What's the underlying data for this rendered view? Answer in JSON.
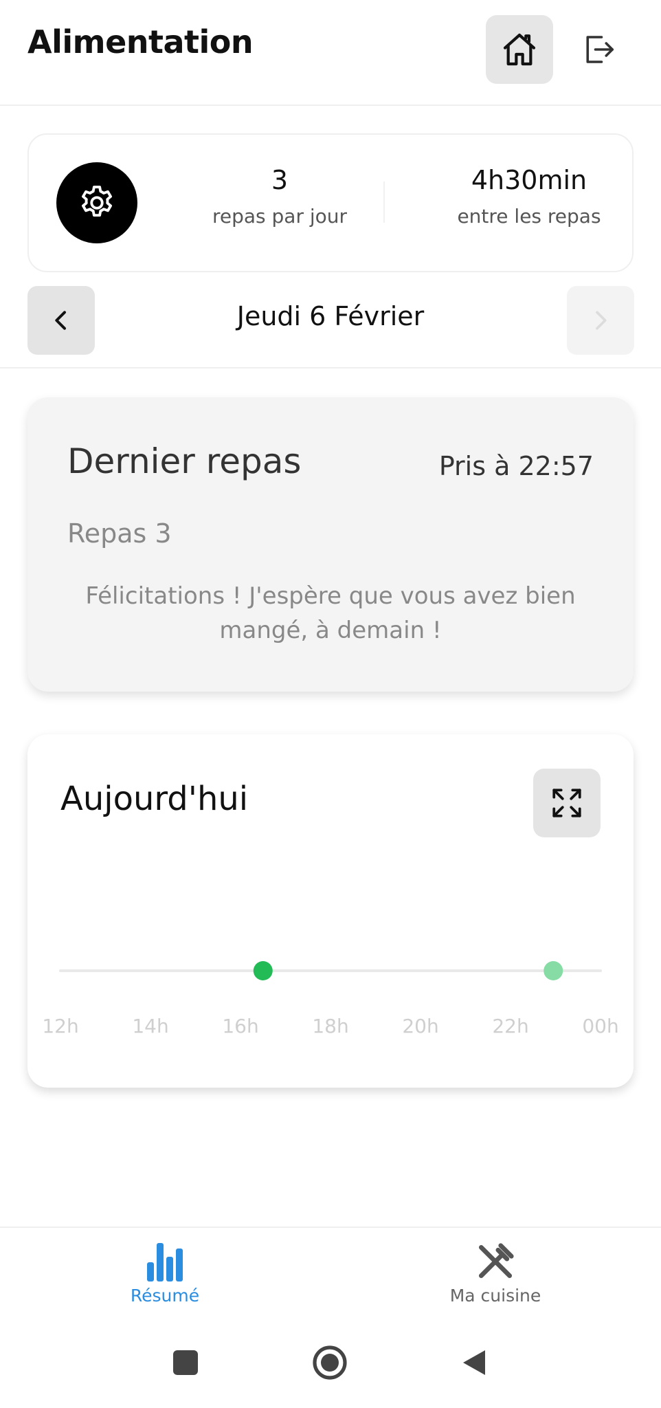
{
  "header": {
    "title": "Alimentation",
    "home_icon": "home-icon",
    "logout_icon": "logout-icon"
  },
  "settings": {
    "gear_icon": "gear-icon",
    "meals_per_day_value": "3",
    "meals_per_day_label": "repas par jour",
    "interval_value": "4h30min",
    "interval_label": "entre les repas"
  },
  "date_nav": {
    "date": "Jeudi 6 Février",
    "prev_icon": "chevron-left-icon",
    "next_icon": "chevron-right-icon"
  },
  "last_meal": {
    "title": "Dernier repas",
    "time": "Pris à 22:57",
    "meal_name": "Repas 3",
    "message": "Félicitations ! J'espère que vous avez bien mangé, à demain !"
  },
  "today": {
    "title": "Aujourd'hui",
    "expand_icon": "expand-icon",
    "axis_ticks": [
      "12h",
      "14h",
      "16h",
      "18h",
      "20h",
      "22h",
      "00h"
    ],
    "meal_times_hours": [
      16.5,
      22.95
    ],
    "colors": {
      "meal_dot": "#22bb55",
      "meal_dot_latest": "#86dca4",
      "axis_line": "#e9e9e9"
    }
  },
  "bottom_nav": {
    "tabs": [
      {
        "label": "Résumé",
        "icon": "bar-chart-icon",
        "active": true
      },
      {
        "label": "Ma cuisine",
        "icon": "utensils-icon",
        "active": false
      }
    ],
    "colors": {
      "active": "#2a8de0",
      "inactive": "#555555"
    }
  },
  "system_nav": {
    "recents_icon": "square-icon",
    "home_icon": "circle-home-icon",
    "back_icon": "back-triangle-icon"
  }
}
